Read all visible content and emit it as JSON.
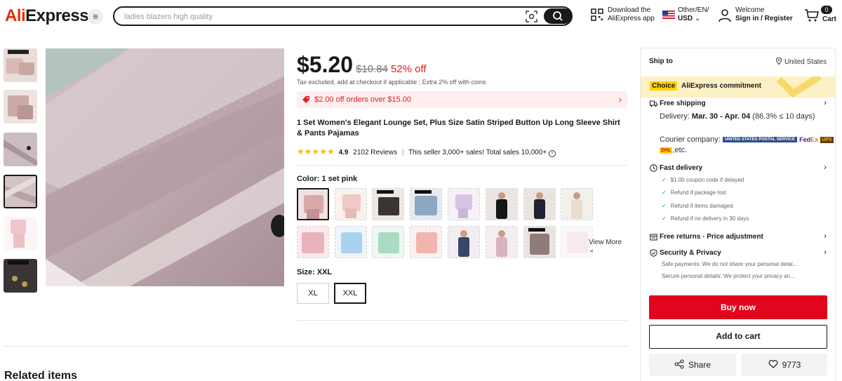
{
  "header": {
    "logo_prefix": "Ali",
    "logo_suffix": "Express",
    "search_placeholder": "ladies blazers high quality",
    "app_line1": "Download the",
    "app_line2": "AliExpress app",
    "lang_line1": "Other/EN/",
    "lang_line2": "USD",
    "welcome": "Welcome",
    "sign_in": "Sign in / Register",
    "cart_count": "0",
    "cart_label": "Cart"
  },
  "product": {
    "price": "$5.20",
    "old_price": "$10.84",
    "discount": "52% off",
    "tax_note": "Tax excluded, add at checkout if applicable ; Extra 2% off with coins",
    "coupon": "$2.00 off orders over $15.00",
    "title": "1 Set Women's Elegant Lounge Set, Plus Size Satin Striped Button Up Long Sleeve Shirt & Pants Pajamas",
    "rating": "4.9",
    "reviews": "2102 Reviews",
    "seller_info": "This seller 3,000+ sales! Total sales 10,000+",
    "color_label": "Color: 1 set pink",
    "view_more": "View More",
    "size_label": "Size: XXL",
    "sizes": [
      "XL",
      "XXL"
    ],
    "selected_size": "XXL"
  },
  "related_title": "Related items",
  "panel": {
    "ship_to": "Ship to",
    "location": "United States",
    "choice_badge": "Choice",
    "choice_text": "AliExpress commitment",
    "free_shipping": "Free shipping",
    "delivery_prefix": "Delivery:",
    "delivery_dates": "Mar. 30 - Apr. 04",
    "delivery_rate": "(86.3% ≤ 10 days)",
    "courier_label": "Courier company:",
    "courier_etc": ",etc.",
    "fast_delivery": "Fast delivery",
    "fast_items": [
      "$1.00 coupon code if delayed",
      "Refund if package lost",
      "Refund if items damaged",
      "Refund if no delivery in 30 days"
    ],
    "free_returns": "Free returns · Price adjustment",
    "security": "Security & Privacy",
    "security_lines": [
      "Safe payments: We do not share your personal detai...",
      "Secure personal details: We protect your privacy an..."
    ],
    "buy_now": "Buy now",
    "add_to_cart": "Add to cart",
    "share": "Share",
    "wishlist_count": "9773"
  },
  "colors": {
    "brand_red": "#e62e04",
    "buy_red": "#e1051d",
    "choice_yellow": "#ffd400",
    "star": "#fcbc00"
  }
}
